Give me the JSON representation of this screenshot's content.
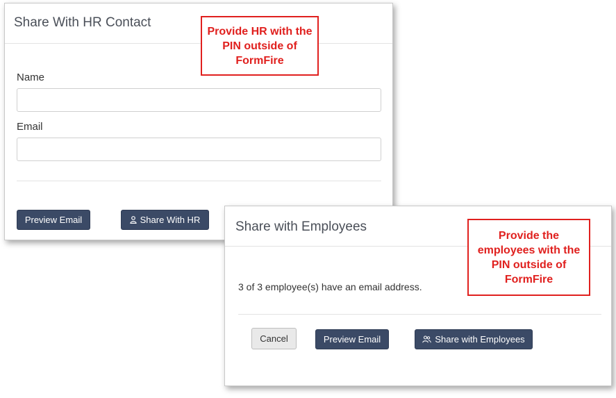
{
  "hr_dialog": {
    "title": "Share With HR Contact",
    "name_label": "Name",
    "name_value": "",
    "email_label": "Email",
    "email_value": "",
    "preview_button": "Preview Email",
    "share_button": "Share With HR",
    "share_icon": "user-icon"
  },
  "employee_dialog": {
    "title": "Share with Employees",
    "status_text": "3 of 3 employee(s) have an email address.",
    "cancel_button": "Cancel",
    "preview_button": "Preview Email",
    "share_button": "Share with Employees",
    "share_icon": "users-icon"
  },
  "callouts": {
    "hr": "Provide HR with the PIN outside of FormFire",
    "employees": "Provide the employees with the PIN outside of FormFire"
  },
  "colors": {
    "primary_button": "#3b4a66",
    "callout_red": "#e0201e",
    "title_text": "#4a4f58"
  }
}
